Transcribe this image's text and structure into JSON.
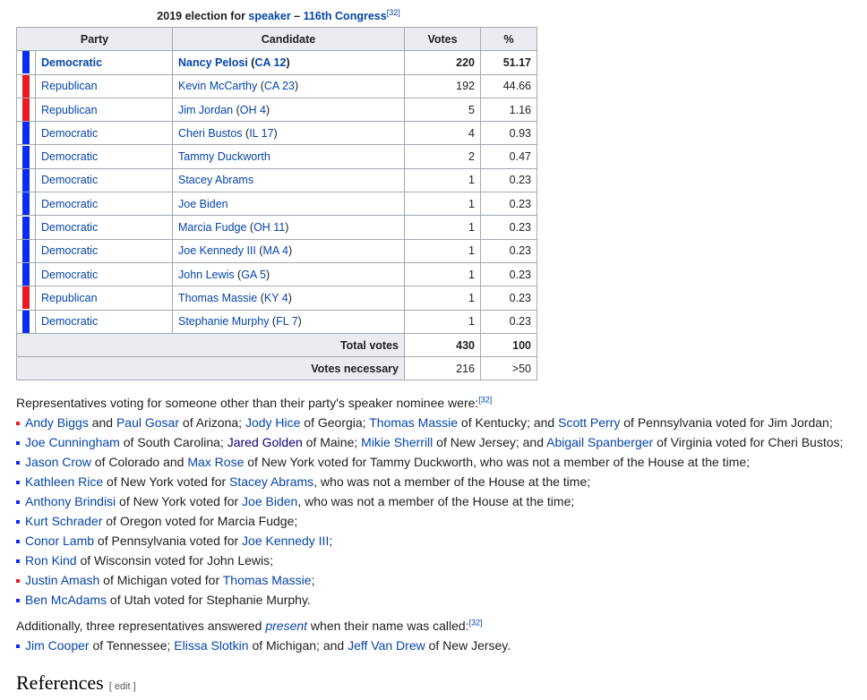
{
  "caption": {
    "prefix": "2019 election for ",
    "speaker_link": "speaker",
    "dash": " – ",
    "congress_link": "116th Congress",
    "ref": "[32]"
  },
  "table": {
    "headers": {
      "party": "Party",
      "candidate": "Candidate",
      "votes": "Votes",
      "pct": "%"
    },
    "colors": {
      "Democratic": "#0b2cf2",
      "Republican": "#e81b23"
    },
    "rows": [
      {
        "party": "Democratic",
        "cand_name": "Nancy Pelosi",
        "cand_dist": "CA 12",
        "votes": "220",
        "pct": "51.17",
        "color": "#0b2cf2"
      },
      {
        "party": "Republican",
        "cand_name": "Kevin McCarthy",
        "cand_dist": "CA 23",
        "votes": "192",
        "pct": "44.66",
        "color": "#e81b23"
      },
      {
        "party": "Republican",
        "cand_name": "Jim Jordan",
        "cand_dist": "OH 4",
        "votes": "5",
        "pct": "1.16",
        "color": "#e81b23"
      },
      {
        "party": "Democratic",
        "cand_name": "Cheri Bustos",
        "cand_dist": "IL 17",
        "votes": "4",
        "pct": "0.93",
        "color": "#0b2cf2"
      },
      {
        "party": "Democratic",
        "cand_name": "Tammy Duckworth",
        "cand_dist": "",
        "votes": "2",
        "pct": "0.47",
        "color": "#0b2cf2"
      },
      {
        "party": "Democratic",
        "cand_name": "Stacey Abrams",
        "cand_dist": "",
        "votes": "1",
        "pct": "0.23",
        "color": "#0b2cf2"
      },
      {
        "party": "Democratic",
        "cand_name": "Joe Biden",
        "cand_dist": "",
        "votes": "1",
        "pct": "0.23",
        "color": "#0b2cf2"
      },
      {
        "party": "Democratic",
        "cand_name": "Marcia Fudge",
        "cand_dist": "OH 11",
        "votes": "1",
        "pct": "0.23",
        "color": "#0b2cf2"
      },
      {
        "party": "Democratic",
        "cand_name": "Joe Kennedy III",
        "cand_dist": "MA 4",
        "votes": "1",
        "pct": "0.23",
        "color": "#0b2cf2"
      },
      {
        "party": "Democratic",
        "cand_name": "John Lewis",
        "cand_dist": "GA 5",
        "votes": "1",
        "pct": "0.23",
        "color": "#0b2cf2"
      },
      {
        "party": "Republican",
        "cand_name": "Thomas Massie",
        "cand_dist": "KY 4",
        "votes": "1",
        "pct": "0.23",
        "color": "#e81b23"
      },
      {
        "party": "Democratic",
        "cand_name": "Stephanie Murphy",
        "cand_dist": "FL 7",
        "votes": "1",
        "pct": "0.23",
        "color": "#0b2cf2"
      }
    ],
    "total": {
      "label": "Total votes",
      "votes": "430",
      "pct": "100"
    },
    "necessary": {
      "label": "Votes necessary",
      "votes": "216",
      "pct": ">50"
    }
  },
  "intro": {
    "text": "Representatives voting for someone other than their party's speaker nominee were:",
    "ref": "[32]"
  },
  "defections": [
    {
      "color": "#e81b23",
      "parts": [
        {
          "t": "Andy Biggs",
          "link": true
        },
        {
          "t": " and "
        },
        {
          "t": "Paul Gosar",
          "link": true
        },
        {
          "t": " of Arizona; "
        },
        {
          "t": "Jody Hice",
          "link": true
        },
        {
          "t": " of Georgia; "
        },
        {
          "t": "Thomas Massie",
          "link": true
        },
        {
          "t": " of Kentucky; and "
        },
        {
          "t": "Scott Perry",
          "link": true
        },
        {
          "t": " of Pennsylvania voted for Jim Jordan;"
        }
      ]
    },
    {
      "color": "#0b2cf2",
      "parts": [
        {
          "t": "Joe Cunningham",
          "link": true
        },
        {
          "t": " of South Carolina; "
        },
        {
          "t": "Jared Golden",
          "link": true,
          "dark": true
        },
        {
          "t": " of Maine; "
        },
        {
          "t": "Mikie Sherrill",
          "link": true
        },
        {
          "t": " of New Jersey; and "
        },
        {
          "t": "Abigail Spanberger",
          "link": true
        },
        {
          "t": " of Virginia voted for Cheri Bustos;"
        }
      ]
    },
    {
      "color": "#0b2cf2",
      "parts": [
        {
          "t": "Jason Crow",
          "link": true
        },
        {
          "t": " of Colorado and "
        },
        {
          "t": "Max Rose",
          "link": true
        },
        {
          "t": " of New York voted for Tammy Duckworth, who was not a member of the House at the time;"
        }
      ]
    },
    {
      "color": "#0b2cf2",
      "parts": [
        {
          "t": "Kathleen Rice",
          "link": true
        },
        {
          "t": " of New York voted for "
        },
        {
          "t": "Stacey Abrams",
          "link": true
        },
        {
          "t": ", who was not a member of the House at the time;"
        }
      ]
    },
    {
      "color": "#0b2cf2",
      "parts": [
        {
          "t": "Anthony Brindisi",
          "link": true
        },
        {
          "t": " of New York voted for "
        },
        {
          "t": "Joe Biden",
          "link": true
        },
        {
          "t": ", who was not a member of the House at the time;"
        }
      ]
    },
    {
      "color": "#0b2cf2",
      "parts": [
        {
          "t": "Kurt Schrader",
          "link": true
        },
        {
          "t": " of Oregon voted for Marcia Fudge;"
        }
      ]
    },
    {
      "color": "#0b2cf2",
      "parts": [
        {
          "t": "Conor Lamb",
          "link": true
        },
        {
          "t": " of Pennsylvania voted for "
        },
        {
          "t": "Joe Kennedy III",
          "link": true
        },
        {
          "t": ";"
        }
      ]
    },
    {
      "color": "#0b2cf2",
      "parts": [
        {
          "t": "Ron Kind",
          "link": true
        },
        {
          "t": " of Wisconsin voted for John Lewis;"
        }
      ]
    },
    {
      "color": "#e81b23",
      "parts": [
        {
          "t": "Justin Amash",
          "link": true
        },
        {
          "t": " of Michigan voted for "
        },
        {
          "t": "Thomas Massie",
          "link": true
        },
        {
          "t": ";"
        }
      ]
    },
    {
      "color": "#0b2cf2",
      "parts": [
        {
          "t": "Ben McAdams",
          "link": true
        },
        {
          "t": " of Utah voted for Stephanie Murphy."
        }
      ]
    }
  ],
  "present": {
    "before": "Additionally, three representatives answered ",
    "word": "present",
    "after": " when their name was called:",
    "ref": "[32]"
  },
  "present_list": {
    "color": "#0b2cf2",
    "parts": [
      {
        "t": "Jim Cooper",
        "link": true
      },
      {
        "t": " of Tennessee; "
      },
      {
        "t": "Elissa Slotkin",
        "link": true
      },
      {
        "t": " of Michigan; and "
      },
      {
        "t": "Jeff Van Drew",
        "link": true
      },
      {
        "t": " of New Jersey."
      }
    ]
  },
  "references": {
    "title": "References",
    "edit": "[ edit ]"
  }
}
